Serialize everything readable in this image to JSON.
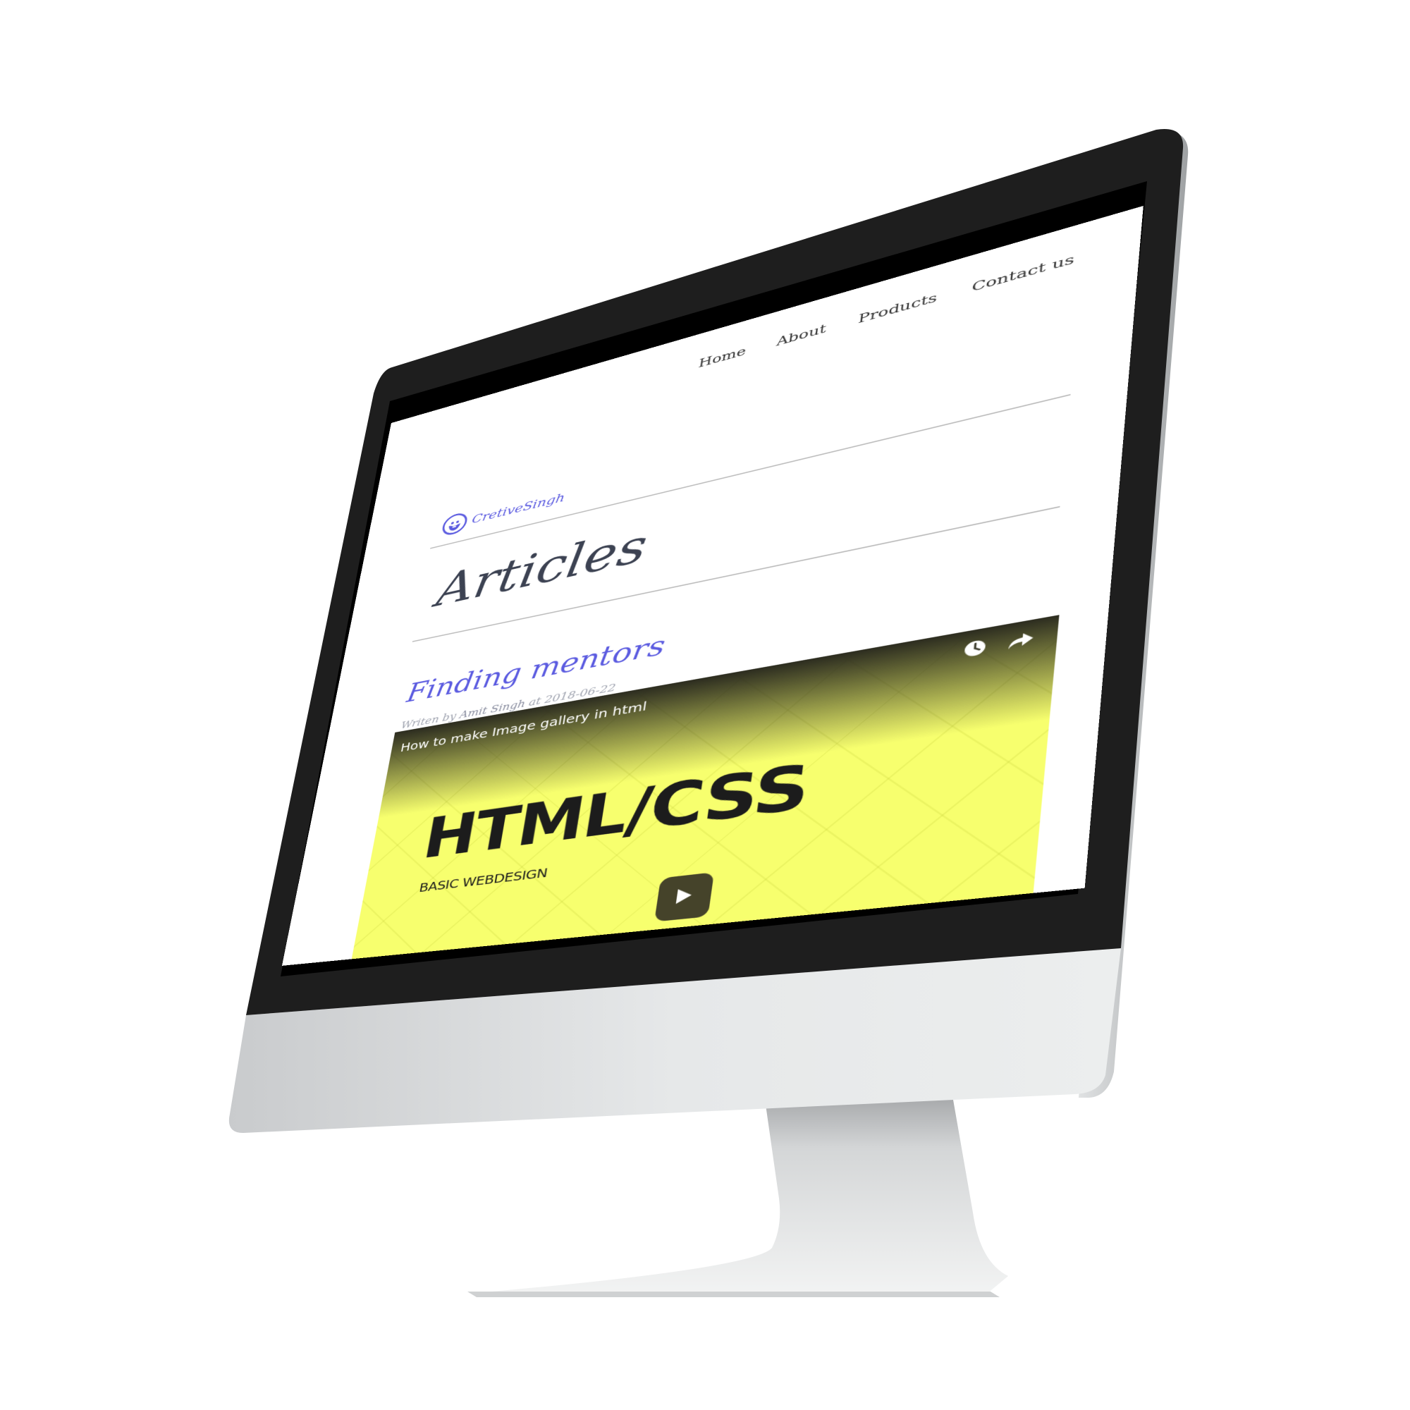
{
  "nav": {
    "items": [
      {
        "label": "Home"
      },
      {
        "label": "About"
      },
      {
        "label": "Products"
      },
      {
        "label": "Contact us"
      }
    ]
  },
  "brand": {
    "name": "CretiveSingh",
    "avatar_icon": "bearded-face-icon",
    "color": "#5b5be0"
  },
  "page": {
    "title": "Articles"
  },
  "article": {
    "title": "Finding mentors",
    "meta_prefix": "Writen by ",
    "author": "Amit Singh",
    "meta_middle": " at ",
    "date": "2018-06-22"
  },
  "video": {
    "caption": "How to make Image gallery in html",
    "heading": "HTML/CSS",
    "subheading": "BASIC WEBDESIGN",
    "background_color": "#f7ff6e",
    "icons": [
      "watch-later-icon",
      "share-icon",
      "play-icon"
    ]
  }
}
